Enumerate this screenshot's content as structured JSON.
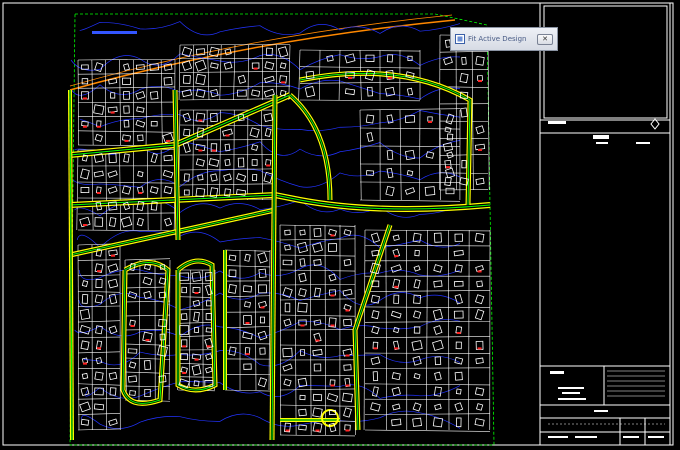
{
  "tooltip": {
    "title": "Fit Active Design",
    "close_icon": "close-icon",
    "design_icon": "fit-view-icon"
  },
  "colors": {
    "background": "#000000",
    "road_edge": "#ffff00",
    "road_line": "#00ff00",
    "lot_line": "#ffffff",
    "contour": "#2233ff",
    "building": "#ffffff",
    "rail": "#ff8800"
  }
}
